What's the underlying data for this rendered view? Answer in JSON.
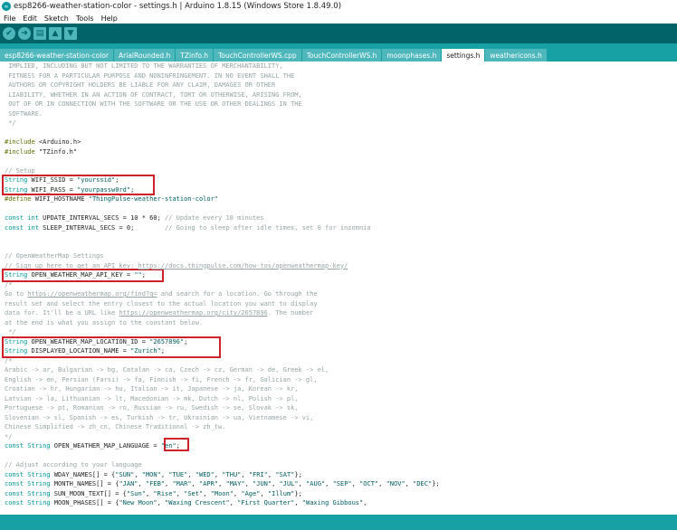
{
  "window": {
    "title": "esp8266-weather-station-color - settings.h | Arduino 1.8.15 (Windows Store 1.8.49.0)"
  },
  "menu": [
    "File",
    "Edit",
    "Sketch",
    "Tools",
    "Help"
  ],
  "toolbar": [
    {
      "name": "verify-button",
      "icon": "check-icon",
      "glyph": "✔"
    },
    {
      "name": "upload-button",
      "icon": "arrow-right-icon",
      "glyph": "➜"
    },
    {
      "name": "new-button",
      "icon": "file-icon",
      "glyph": "▤"
    },
    {
      "name": "open-button",
      "icon": "arrow-up-icon",
      "glyph": "▲"
    },
    {
      "name": "save-button",
      "icon": "arrow-down-icon",
      "glyph": "▼"
    }
  ],
  "tabs": [
    {
      "label": "esp8266-weather-station-color",
      "active": false
    },
    {
      "label": "ArialRounded.h",
      "active": false
    },
    {
      "label": "TZinfo.h",
      "active": false
    },
    {
      "label": "TouchControllerWS.cpp",
      "active": false
    },
    {
      "label": "TouchControllerWS.h",
      "active": false
    },
    {
      "label": "moonphases.h",
      "active": false
    },
    {
      "label": "settings.h",
      "active": true
    },
    {
      "label": "weathericons.h",
      "active": false
    }
  ],
  "code": [
    [
      [
        "c",
        " IMPLIED, INCLUDING BUT NOT LIMITED TO THE WARRANTIES OF MERCHANTABILITY,"
      ]
    ],
    [
      [
        "c",
        " FITNESS FOR A PARTICULAR PURPOSE AND NONINFRINGEMENT. IN NO EVENT SHALL THE"
      ]
    ],
    [
      [
        "c",
        " AUTHORS OR COPYRIGHT HOLDERS BE LIABLE FOR ANY CLAIM, DAMAGES OR OTHER"
      ]
    ],
    [
      [
        "c",
        " LIABILITY, WHETHER IN AN ACTION OF CONTRACT, TORT OR OTHERWISE, ARISING FROM,"
      ]
    ],
    [
      [
        "c",
        " OUT OF OR IN CONNECTION WITH THE SOFTWARE OR THE USE OR OTHER DEALINGS IN THE"
      ]
    ],
    [
      [
        "c",
        " SOFTWARE."
      ]
    ],
    [
      [
        "c",
        " */"
      ]
    ],
    [],
    [
      [
        "pp",
        "#include"
      ],
      [
        "t",
        " <Arduino.h>"
      ]
    ],
    [
      [
        "pp",
        "#include"
      ],
      [
        "t",
        " \"TZinfo.h\""
      ]
    ],
    [],
    [
      [
        "c",
        "// Setup"
      ]
    ],
    [
      [
        "kw",
        "String"
      ],
      [
        "t",
        " WIFI_SSID = "
      ],
      [
        "str",
        "\"yourssid\""
      ],
      [
        "t",
        ";"
      ]
    ],
    [
      [
        "kw",
        "String"
      ],
      [
        "t",
        " WIFI_PASS = "
      ],
      [
        "str",
        "\"yourpassw0rd\""
      ],
      [
        "t",
        ";"
      ]
    ],
    [
      [
        "pp",
        "#define"
      ],
      [
        "t",
        " WIFI_HOSTNAME "
      ],
      [
        "str",
        "\"ThingPulse-weather-station-color\""
      ]
    ],
    [],
    [
      [
        "kw",
        "const int"
      ],
      [
        "t",
        " UPDATE_INTERVAL_SECS = 10 * 60; "
      ],
      [
        "c",
        "// Update every 10 minutes"
      ]
    ],
    [
      [
        "kw",
        "const int"
      ],
      [
        "t",
        " SLEEP_INTERVAL_SECS = 0;        "
      ],
      [
        "c",
        "// Going to sleep after idle times, set 0 for insomnia"
      ]
    ],
    [],
    [],
    [
      [
        "c",
        "// OpenWeatherMap Settings"
      ]
    ],
    [
      [
        "c",
        "// Sign up here to get an API key: "
      ],
      [
        "lnk",
        "https://docs.thingpulse.com/how-tos/openweathermap-key/"
      ]
    ],
    [
      [
        "kw",
        "String"
      ],
      [
        "t",
        " OPEN_WEATHER_MAP_API_KEY = "
      ],
      [
        "str",
        "\"\""
      ],
      [
        "t",
        ";"
      ]
    ],
    [
      [
        "c",
        "/*"
      ]
    ],
    [
      [
        "c",
        "Go to "
      ],
      [
        "lnk",
        "https://openweathermap.org/find?q="
      ],
      [
        "c",
        " and search for a location. Go through the"
      ]
    ],
    [
      [
        "c",
        "result set and select the entry closest to the actual location you want to display"
      ]
    ],
    [
      [
        "c",
        "data for. It'll be a URL like "
      ],
      [
        "lnk",
        "https://openweathermap.org/city/2657896"
      ],
      [
        "c",
        ". The number"
      ]
    ],
    [
      [
        "c",
        "at the end is what you assign to the constant below."
      ]
    ],
    [
      [
        "c",
        " */"
      ]
    ],
    [
      [
        "kw",
        "String"
      ],
      [
        "t",
        " OPEN_WEATHER_MAP_LOCATION_ID = "
      ],
      [
        "str",
        "\"2657896\""
      ],
      [
        "t",
        ";"
      ]
    ],
    [
      [
        "kw",
        "String"
      ],
      [
        "t",
        " DISPLAYED_LOCATION_NAME = "
      ],
      [
        "str",
        "\"Zurich\""
      ],
      [
        "t",
        ";"
      ]
    ],
    [
      [
        "c",
        "/*"
      ]
    ],
    [
      [
        "c",
        "Arabic -> ar, Bulgarian -> bg, Catalan -> ca, Czech -> cz, German -> de, Greek -> el,"
      ]
    ],
    [
      [
        "c",
        "English -> en, Persian (Farsi) -> fa, Finnish -> fi, French -> fr, Galician -> gl,"
      ]
    ],
    [
      [
        "c",
        "Croatian -> hr, Hungarian -> hu, Italian -> it, Japanese -> ja, Korean -> kr,"
      ]
    ],
    [
      [
        "c",
        "Latvian -> la, Lithuanian -> lt, Macedonian -> mk, Dutch -> nl, Polish -> pl,"
      ]
    ],
    [
      [
        "c",
        "Portuguese -> pt, Romanian -> ro, Russian -> ru, Swedish -> se, Slovak -> sk,"
      ]
    ],
    [
      [
        "c",
        "Slovenian -> sl, Spanish -> es, Turkish -> tr, Ukrainian -> ua, Vietnamese -> vi,"
      ]
    ],
    [
      [
        "c",
        "Chinese Simplified -> zh_cn, Chinese Traditional -> zh_tw."
      ]
    ],
    [
      [
        "c",
        "*/"
      ]
    ],
    [
      [
        "kw",
        "const String"
      ],
      [
        "t",
        " OPEN_WEATHER_MAP_LANGUAGE = "
      ],
      [
        "str",
        "\"en\""
      ],
      [
        "t",
        ";"
      ]
    ],
    [],
    [
      [
        "c",
        "// Adjust according to your language"
      ]
    ],
    [
      [
        "kw",
        "const String"
      ],
      [
        "t",
        " WDAY_NAMES[] = {"
      ],
      [
        "str",
        "\"SUN\""
      ],
      [
        "t",
        ", "
      ],
      [
        "str",
        "\"MON\""
      ],
      [
        "t",
        ", "
      ],
      [
        "str",
        "\"TUE\""
      ],
      [
        "t",
        ", "
      ],
      [
        "str",
        "\"WED\""
      ],
      [
        "t",
        ", "
      ],
      [
        "str",
        "\"THU\""
      ],
      [
        "t",
        ", "
      ],
      [
        "str",
        "\"FRI\""
      ],
      [
        "t",
        ", "
      ],
      [
        "str",
        "\"SAT\""
      ],
      [
        "t",
        "};"
      ]
    ],
    [
      [
        "kw",
        "const String"
      ],
      [
        "t",
        " MONTH_NAMES[] = {"
      ],
      [
        "str",
        "\"JAN\""
      ],
      [
        "t",
        ", "
      ],
      [
        "str",
        "\"FEB\""
      ],
      [
        "t",
        ", "
      ],
      [
        "str",
        "\"MAR\""
      ],
      [
        "t",
        ", "
      ],
      [
        "str",
        "\"APR\""
      ],
      [
        "t",
        ", "
      ],
      [
        "str",
        "\"MAY\""
      ],
      [
        "t",
        ", "
      ],
      [
        "str",
        "\"JUN\""
      ],
      [
        "t",
        ", "
      ],
      [
        "str",
        "\"JUL\""
      ],
      [
        "t",
        ", "
      ],
      [
        "str",
        "\"AUG\""
      ],
      [
        "t",
        ", "
      ],
      [
        "str",
        "\"SEP\""
      ],
      [
        "t",
        ", "
      ],
      [
        "str",
        "\"OCT\""
      ],
      [
        "t",
        ", "
      ],
      [
        "str",
        "\"NOV\""
      ],
      [
        "t",
        ", "
      ],
      [
        "str",
        "\"DEC\""
      ],
      [
        "t",
        "};"
      ]
    ],
    [
      [
        "kw",
        "const String"
      ],
      [
        "t",
        " SUN_MOON_TEXT[] = {"
      ],
      [
        "str",
        "\"Sun\""
      ],
      [
        "t",
        ", "
      ],
      [
        "str",
        "\"Rise\""
      ],
      [
        "t",
        ", "
      ],
      [
        "str",
        "\"Set\""
      ],
      [
        "t",
        ", "
      ],
      [
        "str",
        "\"Moon\""
      ],
      [
        "t",
        ", "
      ],
      [
        "str",
        "\"Age\""
      ],
      [
        "t",
        ", "
      ],
      [
        "str",
        "\"Illum\""
      ],
      [
        "t",
        "};"
      ]
    ],
    [
      [
        "kw",
        "const String"
      ],
      [
        "t",
        " MOON_PHASES[] = {"
      ],
      [
        "str",
        "\"New Moon\""
      ],
      [
        "t",
        ", "
      ],
      [
        "str",
        "\"Waxing Crescent\""
      ],
      [
        "t",
        ", "
      ],
      [
        "str",
        "\"First Quarter\""
      ],
      [
        "t",
        ", "
      ],
      [
        "str",
        "\"Waxing Gibbous\""
      ],
      [
        "t",
        ","
      ]
    ]
  ],
  "colors": {
    "toolbar": "#006468",
    "tabs": "#17a1a5",
    "highlight": "#d0202a"
  }
}
